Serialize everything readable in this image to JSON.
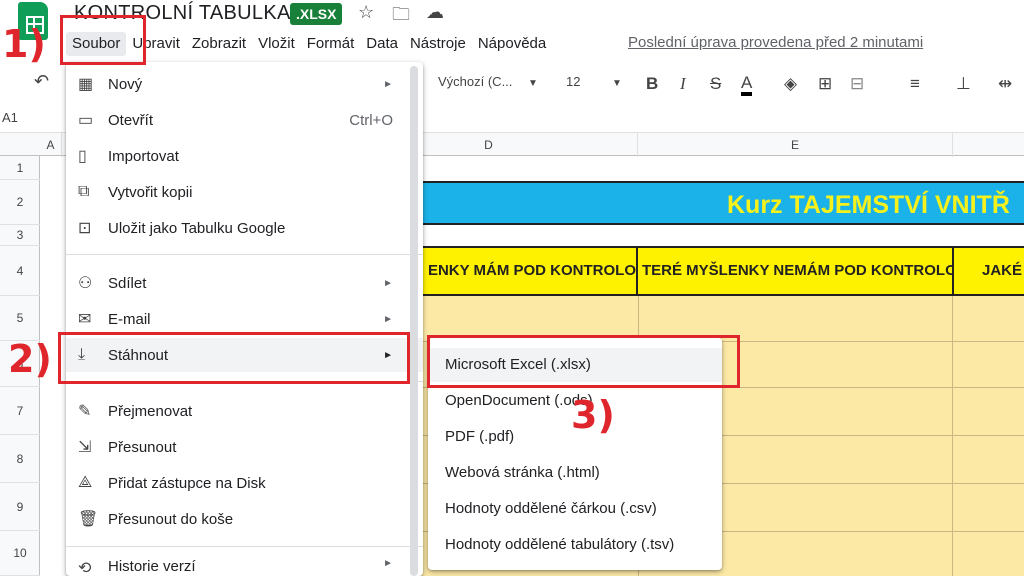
{
  "app": {
    "title": "KONTROLNÍ TABULKA",
    "badge": ".XLSX",
    "last_edit": "Poslední úprava provedena před 2 minutami",
    "icons": [
      "sheets-logo-icon",
      "star-icon",
      "move-folder-icon",
      "cloud-icon"
    ]
  },
  "menubar": [
    "Soubor",
    "Upravit",
    "Zobrazit",
    "Vložit",
    "Formát",
    "Data",
    "Nástroje",
    "Nápověda"
  ],
  "toolbar": {
    "font": "Výchozí (C...",
    "font_size": "12",
    "undo_icon": "↶",
    "bold": "B",
    "italic": "I",
    "strike": "S",
    "text_color": "A"
  },
  "cell_ref": "A1",
  "columns": [
    "A",
    "D",
    "E"
  ],
  "rows": [
    "1",
    "2",
    "3",
    "4",
    "5",
    "6",
    "7",
    "8",
    "9",
    "10"
  ],
  "sheet": {
    "banner": "Kurz TAJEMSTVÍ VNITŘ",
    "headers": [
      "ENKY MÁM POD KONTROLO",
      "TERÉ MYŠLENKY NEMÁM POD KONTROLO",
      "JAKÉ M"
    ]
  },
  "file_menu": {
    "items": [
      {
        "label": "Nový",
        "icon": "new-icon",
        "glyph": "▦",
        "arrow": true
      },
      {
        "label": "Otevřít",
        "icon": "folder-icon",
        "glyph": "▭",
        "shortcut": "Ctrl+O"
      },
      {
        "label": "Importovat",
        "icon": "import-icon",
        "glyph": "▯"
      },
      {
        "label": "Vytvořit kopii",
        "icon": "copy-icon",
        "glyph": "⧉"
      },
      {
        "label": "Uložit jako Tabulku Google",
        "icon": "save-icon",
        "glyph": "⊡"
      },
      {
        "label": "Sdílet",
        "icon": "share-icon",
        "glyph": "⚇",
        "arrow": true
      },
      {
        "label": "E-mail",
        "icon": "mail-icon",
        "glyph": "✉",
        "arrow": true
      },
      {
        "label": "Stáhnout",
        "icon": "download-icon",
        "glyph": "⤓",
        "arrow": true
      },
      {
        "label": "Přejmenovat",
        "icon": "rename-icon",
        "glyph": "✎"
      },
      {
        "label": "Přesunout",
        "icon": "move-icon",
        "glyph": "⇲"
      },
      {
        "label": "Přidat zástupce na Disk",
        "icon": "drive-shortcut-icon",
        "glyph": "⟁"
      },
      {
        "label": "Přesunout do koše",
        "icon": "trash-icon",
        "glyph": "🗑"
      },
      {
        "label": "Historie verzí",
        "icon": "history-icon",
        "glyph": "⟲",
        "arrow": true
      }
    ]
  },
  "download_menu": [
    "Microsoft Excel (.xlsx)",
    "OpenDocument (.ods)",
    "PDF (.pdf)",
    "Webová stránka (.html)",
    "Hodnoty oddělené čárkou (.csv)",
    "Hodnoty oddělené tabulátory (.tsv)"
  ],
  "annotations": [
    "1)",
    "2)",
    "3)"
  ],
  "colors": {
    "annotation": "#e0262d",
    "banner_bg": "#1ab2e8",
    "banner_text": "#f7f11b",
    "header_bg": "#fff200",
    "body_bg": "#fde9a6",
    "badge_bg": "#188038"
  }
}
